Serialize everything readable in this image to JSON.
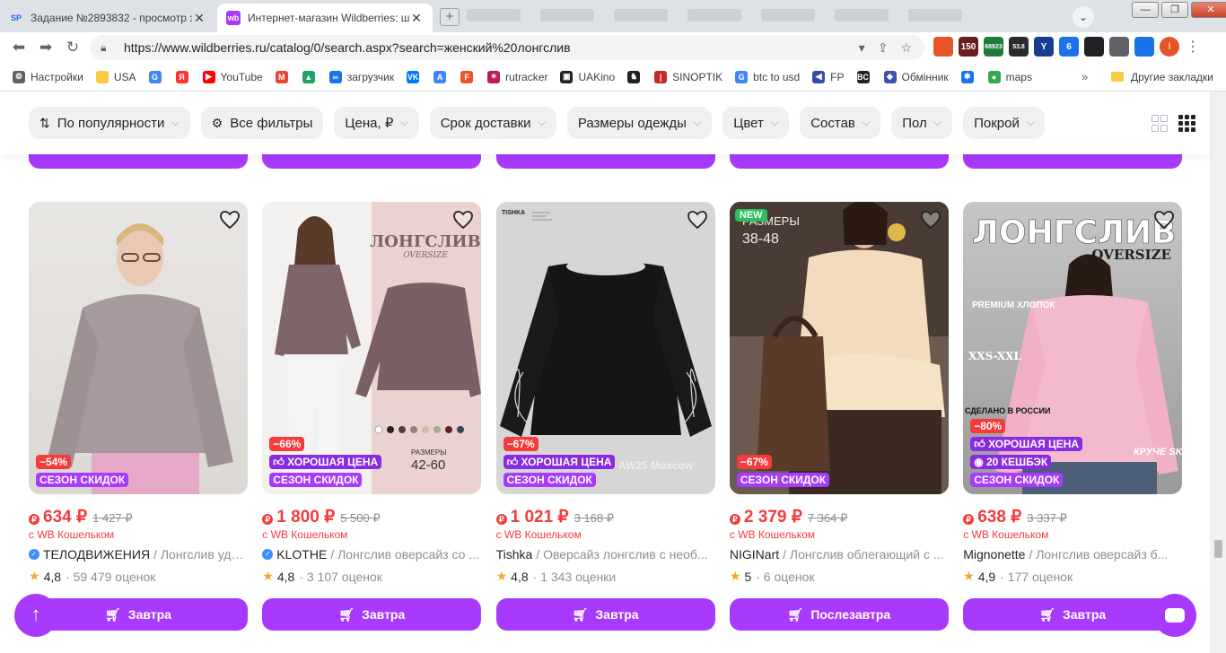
{
  "browser": {
    "tabs": [
      {
        "favicon": "SP",
        "title": "Задание №2893832 - просмотр з"
      },
      {
        "favicon": "wb",
        "title": "Интернет-магазин Wildberries: ш"
      }
    ],
    "profile_initial": "S",
    "url": "https://www.wildberries.ru/catalog/0/search.aspx?search=женский%20лонгслив",
    "extensions": [
      {
        "name": "fire-extension-icon",
        "label": "",
        "color": "#e8542a"
      },
      {
        "name": "calendar-extension-icon",
        "label": "150",
        "color": "#6b1d1d"
      },
      {
        "name": "bitcoin-extension-icon",
        "label": "68923",
        "color": "#1e7b3a"
      },
      {
        "name": "ltc-extension-icon",
        "label": "53.8",
        "color": "#2b2b2b"
      },
      {
        "name": "y-extension-icon",
        "label": "Y",
        "color": "#1a3d8f"
      },
      {
        "name": "shield-extension-icon",
        "label": "6",
        "color": "#1a73e8"
      },
      {
        "name": "cursor-extension-icon",
        "label": "",
        "color": "#202124"
      },
      {
        "name": "puzzle-extension-icon",
        "label": "",
        "color": "#5f6368"
      },
      {
        "name": "download-icon",
        "label": "",
        "color": "#1a73e8"
      }
    ],
    "avatar_initial": "I",
    "bookmarks": [
      {
        "icon": "gear",
        "label": "Настройки",
        "color": "#5f6368"
      },
      {
        "icon": "folder",
        "label": "USA",
        "color": "#f9cb45"
      },
      {
        "icon": "google",
        "label": "",
        "color": "#4285f4"
      },
      {
        "icon": "yandex",
        "label": "",
        "color": "#f33"
      },
      {
        "icon": "youtube",
        "label": "YouTube",
        "color": "#f00"
      },
      {
        "icon": "gmail",
        "label": "",
        "color": "#ea4335"
      },
      {
        "icon": "drive",
        "label": "",
        "color": "#1fa463"
      },
      {
        "icon": "loader",
        "label": "загрузчик",
        "color": "#1a73e8"
      },
      {
        "icon": "vk",
        "label": "",
        "color": "#0077ff"
      },
      {
        "icon": "translate",
        "label": "",
        "color": "#4285f4"
      },
      {
        "icon": "f-app",
        "label": "",
        "color": "#e8542a"
      },
      {
        "icon": "rutracker",
        "label": "rutracker",
        "color": "#c2185b"
      },
      {
        "icon": "uakino",
        "label": "UAKino",
        "color": "#202124"
      },
      {
        "icon": "chess",
        "label": "",
        "color": "#202124"
      },
      {
        "icon": "thermometer",
        "label": "SINOPTIK",
        "color": "#c62828"
      },
      {
        "icon": "google",
        "label": "btc to usd",
        "color": "#4285f4"
      },
      {
        "icon": "fp",
        "label": "FP",
        "color": "#3949ab"
      },
      {
        "icon": "bc",
        "label": "",
        "color": "#202124"
      },
      {
        "icon": "exchange",
        "label": "Обмінник",
        "color": "#3f51b5"
      },
      {
        "icon": "snowflake",
        "label": "",
        "color": "#1a73e8"
      },
      {
        "icon": "maps",
        "label": "maps",
        "color": "#34a853"
      }
    ],
    "bookmarks_more": "»",
    "other_bookmarks": "Другие закладки"
  },
  "filters": {
    "sort": "По популярности",
    "all": "Все фильтры",
    "chips": [
      "Цена, ₽",
      "Срок доставки",
      "Размеры одежды",
      "Цвет",
      "Состав",
      "Пол",
      "Покрой"
    ]
  },
  "products": [
    {
      "badges": [
        {
          "type": "sale",
          "text": "−54%"
        },
        {
          "type": "season",
          "text": "СЕЗОН СКИДОК"
        }
      ],
      "new": "",
      "price": "634 ₽",
      "old_price": "1 427 ₽",
      "wallet": "с WB Кошельком",
      "verified": true,
      "brand": "ТЕЛОДВИЖЕНИЯ",
      "name": "/ Лонгслив удл...",
      "rating": "4,8",
      "reviews": "· 59 479 оценок",
      "delivery": "Завтра",
      "photo_text": ""
    },
    {
      "badges": [
        {
          "type": "sale",
          "text": "−66%"
        },
        {
          "type": "purple",
          "text": "ХОРОШАЯ ЦЕНА"
        },
        {
          "type": "season",
          "text": "СЕЗОН СКИДОК"
        }
      ],
      "new": "",
      "price": "1 800 ₽",
      "old_price": "5 500 ₽",
      "wallet": "с WB Кошельком",
      "verified": true,
      "brand": "KLOTHE",
      "name": "/ Лонгслив оверсайз со ...",
      "rating": "4,8",
      "reviews": "· 3 107 оценок",
      "delivery": "Завтра",
      "photo_text": "ЛОНГСЛИВ",
      "photo_sub": "OVERSIZE",
      "photo_sizes_label": "РАЗМЕРЫ",
      "photo_sizes": "42-60"
    },
    {
      "badges": [
        {
          "type": "sale",
          "text": "−67%"
        },
        {
          "type": "purple",
          "text": "ХОРОШАЯ ЦЕНА"
        },
        {
          "type": "season",
          "text": "СЕЗОН СКИДОК"
        }
      ],
      "new": "",
      "price": "1 021 ₽",
      "old_price": "3 168 ₽",
      "wallet": "с WB Кошельком",
      "verified": false,
      "brand": "Tishka",
      "name": "/ Оверсайз лонгслив с необ...",
      "rating": "4,8",
      "reviews": "· 1 343 оценки",
      "delivery": "Завтра",
      "photo_text": "AW25 Moscow",
      "photo_sub": "TISHKA"
    },
    {
      "badges": [
        {
          "type": "sale",
          "text": "−67%"
        },
        {
          "type": "season",
          "text": "СЕЗОН СКИДОК"
        }
      ],
      "new": "NEW",
      "price": "2 379 ₽",
      "old_price": "7 364 ₽",
      "wallet": "с WB Кошельком",
      "verified": false,
      "brand": "NIGINart",
      "name": "/ Лонгслив облегающий с ...",
      "rating": "5",
      "reviews": "· 6 оценок",
      "delivery": "Послезавтра",
      "photo_text": "РАЗМЕРЫ",
      "photo_sub": "38-48"
    },
    {
      "badges": [
        {
          "type": "sale",
          "text": "−80%"
        },
        {
          "type": "purple",
          "text": "ХОРОШАЯ ЦЕНА"
        },
        {
          "type": "purple",
          "text": "20 КЕШБЭК"
        },
        {
          "type": "season",
          "text": "СЕЗОН СКИДОК"
        }
      ],
      "new": "",
      "price": "638 ₽",
      "old_price": "3 337 ₽",
      "wallet": "с WB Кошельком",
      "verified": false,
      "brand": "Mignonette",
      "name": "/ Лонгслив оверсайз б...",
      "rating": "4,9",
      "reviews": "· 177 оценок",
      "delivery": "Завтра",
      "photo_text": "ЛОНГСЛИВ",
      "photo_sub": "OVERSIZE",
      "photo_tag1": "PREMIUM ХЛОПОК",
      "photo_tag2": "XXS-XXL",
      "photo_tag3": "СДЕЛАНО В РОССИИ",
      "photo_tag4": "КРУЧЕ SKIMS"
    }
  ],
  "colors": {
    "accent": "#a73afd",
    "sale": "#f53b3b",
    "muted": "#8d8d99"
  }
}
